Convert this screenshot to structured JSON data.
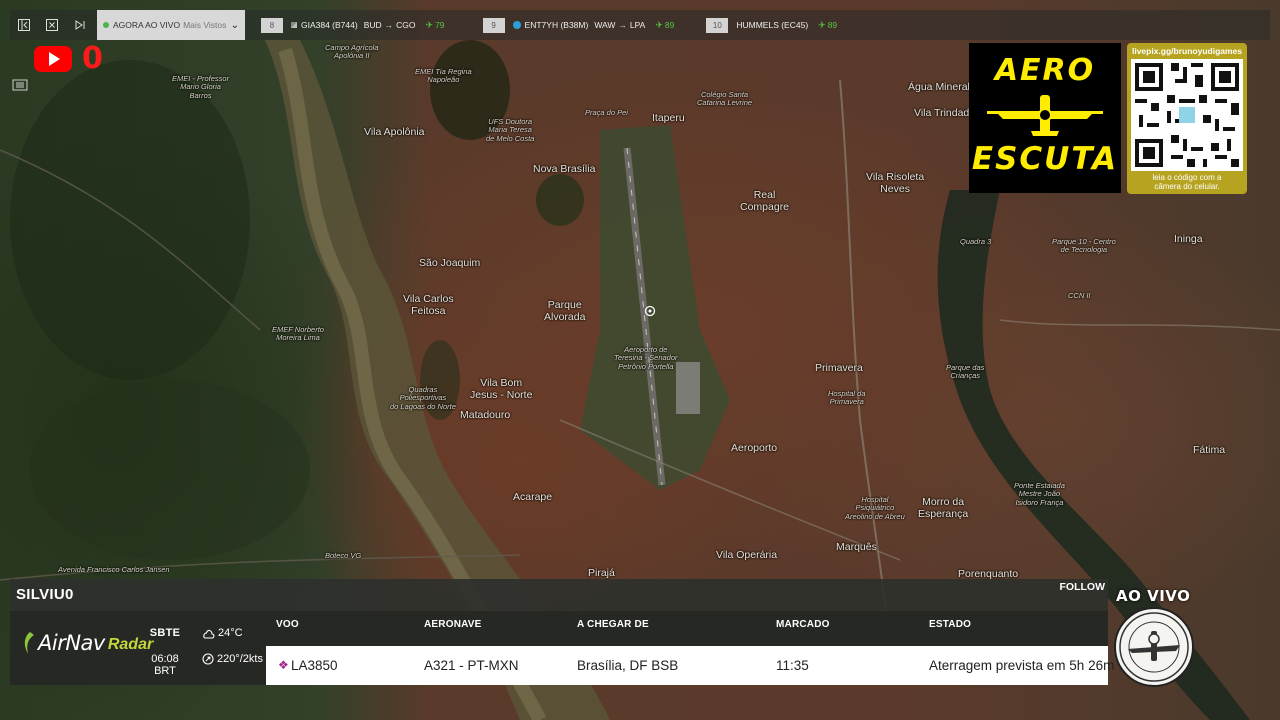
{
  "topbar": {
    "live_label": "AGORA AO VIVO",
    "live_sub": "Mais Vistos",
    "flights": [
      {
        "num": "8",
        "callsign": "GIA384 (B744)",
        "from": "BUD",
        "to": "CGO",
        "alt": "79"
      },
      {
        "num": "9",
        "callsign": "ENT7YH (B38M)",
        "from": "WAW",
        "to": "LPA",
        "alt": "89"
      },
      {
        "num": "10",
        "callsign": "HUMMELS (EC45)",
        "from": "",
        "to": "",
        "alt": "89"
      }
    ]
  },
  "youtube": {
    "count": "0"
  },
  "aero": {
    "word1": "AERO",
    "word2": "ESCUTA"
  },
  "qr": {
    "url": "livepix.gg/brunoyudigames",
    "caption_1": "leia o código com a",
    "caption_2": "câmera do celular."
  },
  "map_labels": {
    "campo_agricola": "Campo Agrícola\nApolônia II",
    "emei_prof": "EMEI - Professor\nMario Gloria\nBarros",
    "emei_tia": "EMEI Tia Regina\nNapoleão",
    "vila_apolonia": "Vila Apolônia",
    "ufs_doutora": "UFS Doutora\nMaria Teresa\nde Melo Costa",
    "praca_pei": "Praça do Pei",
    "itaperu": "Itaperu",
    "colegio": "Colégio Santa\nCatarina Levrine",
    "agua_mineral": "Água Mineral",
    "vila_trindade": "Vila Trindade",
    "nova_brasilia": "Nova Brasília",
    "vila_risoleta": "Vila Risoleta\nNeves",
    "real_compagre": "Real\nCompagre",
    "quadra_3": "Quadra 3",
    "parque_10": "Parque 10 - Centro\nde Tecnologia",
    "ininga": "Ininga",
    "sao_joaquim": "São Joaquim",
    "vila_carlos": "Vila Carlos\nFeitosa",
    "parque_alvorada": "Parque\nAlvorada",
    "ccn": "CCN II",
    "emef_norberto": "EMEF Norberto\nMoreira Lima",
    "aeroporto_teresina": "Aeroporto de\nTeresina - Senador\nPetrônio Portella",
    "primavera": "Primavera",
    "parque_criancas": "Parque das\nCrianças",
    "vila_bom_jesus": "Vila Bom\nJesus - Norte",
    "quadras": "Quadras\nPoliesportivas\ndo Lagoas do Norte",
    "matadouro": "Matadouro",
    "hospital_primavera": "Hospital da\nPrimavera",
    "aeroporto": "Aeroporto",
    "fatima": "Fátima",
    "acarape": "Acarape",
    "hospital_areolino": "Hospital\nPsiquiátrico\nAreolino de Abreu",
    "morro": "Morro da\nEsperança",
    "ponte": "Ponte Estaiada\nMestre João\nIsidoro França",
    "marques": "Marquês",
    "vila_operaria": "Vila Operária",
    "boteco": "Boteco VG",
    "avenida": "Avenida Francisco Carlos Jansen",
    "piraja": "Pirajá",
    "porenquanto": "Porenquanto"
  },
  "panel": {
    "tracker_name": "SILVIU0",
    "follow_label": "FOLLOW",
    "brand_airnav": "AirNav",
    "brand_radar": "Radar",
    "station_code": "SBTE",
    "station_time": "06:08 BRT",
    "temperature": "24°C",
    "wind": "220°/2kts",
    "headers": {
      "flight": "VOO",
      "aircraft": "AERONAVE",
      "arriving_from": "A CHEGAR DE",
      "scheduled": "MARCADO",
      "status": "ESTADO"
    },
    "row": {
      "flight": "LA3850",
      "aircraft": "A321 - PT-MXN",
      "arriving_from": "Brasília, DF BSB",
      "scheduled": "11:35",
      "status": "Aterragem prevista em 5h 26m"
    }
  },
  "ao_vivo": "AO VIVO",
  "colors": {
    "accent_green": "#56c542",
    "youtube_red": "#ff0000",
    "aero_yellow": "#ffec00",
    "qr_gold": "#b6a320",
    "airline_purple": "#a3238e"
  }
}
